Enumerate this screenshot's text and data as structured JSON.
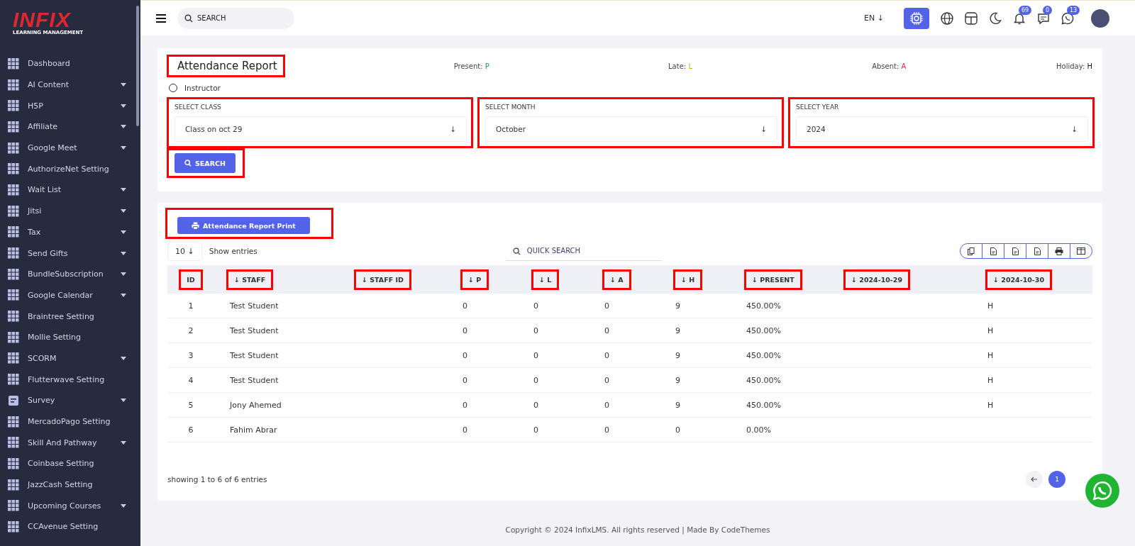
{
  "logo": {
    "brand": "INFIX",
    "tagline": "LEARNING MANAGEMENT"
  },
  "sidebar": {
    "items": [
      {
        "label": "Dashboard",
        "kind": "grid",
        "has_submenu": false
      },
      {
        "label": "AI Content",
        "kind": "grid",
        "has_submenu": true
      },
      {
        "label": "H5P",
        "kind": "grid",
        "has_submenu": true
      },
      {
        "label": "Affiliate",
        "kind": "grid",
        "has_submenu": true
      },
      {
        "label": "Google Meet",
        "kind": "grid",
        "has_submenu": true
      },
      {
        "label": "AuthorizeNet Setting",
        "kind": "grid",
        "has_submenu": false
      },
      {
        "label": "Wait List",
        "kind": "grid",
        "has_submenu": true
      },
      {
        "label": "Jitsi",
        "kind": "grid",
        "has_submenu": true
      },
      {
        "label": "Tax",
        "kind": "grid",
        "has_submenu": true
      },
      {
        "label": "Send Gifts",
        "kind": "grid",
        "has_submenu": true
      },
      {
        "label": "BundleSubscription",
        "kind": "grid",
        "has_submenu": true
      },
      {
        "label": "Google Calendar",
        "kind": "grid",
        "has_submenu": true
      },
      {
        "label": "Braintree Setting",
        "kind": "grid",
        "has_submenu": false
      },
      {
        "label": "Mollie Setting",
        "kind": "grid",
        "has_submenu": false
      },
      {
        "label": "SCORM",
        "kind": "grid",
        "has_submenu": true
      },
      {
        "label": "Flutterwave Setting",
        "kind": "grid",
        "has_submenu": false
      },
      {
        "label": "Survey",
        "kind": "form",
        "has_submenu": true
      },
      {
        "label": "MercadoPago Setting",
        "kind": "grid",
        "has_submenu": false
      },
      {
        "label": "Skill And Pathway",
        "kind": "grid",
        "has_submenu": true
      },
      {
        "label": "Coinbase Setting",
        "kind": "grid",
        "has_submenu": false
      },
      {
        "label": "JazzCash Setting",
        "kind": "grid",
        "has_submenu": false
      },
      {
        "label": "Upcoming Courses",
        "kind": "grid",
        "has_submenu": true
      },
      {
        "label": "CCAvenue Setting",
        "kind": "grid",
        "has_submenu": false
      }
    ]
  },
  "topbar": {
    "search_placeholder": "SEARCH",
    "language": "EN",
    "language_arrow": "↓",
    "badges": [
      {
        "kind": "bell",
        "count": "69"
      },
      {
        "kind": "chat",
        "count": "0"
      },
      {
        "kind": "whatsapp",
        "count": "13"
      }
    ]
  },
  "report": {
    "title": "Attendance Report",
    "title_highlighted": true,
    "legend": [
      {
        "label": "Present: ",
        "code": "P",
        "color": "#1aa34a"
      },
      {
        "label": "Late: ",
        "code": "L",
        "color": "#e0b000"
      },
      {
        "label": "Absent: ",
        "code": "A",
        "color": "#e0303a"
      },
      {
        "label": "Holiday: ",
        "code": "H",
        "color": "#222222"
      }
    ],
    "role": {
      "label": "Instructor",
      "selected": false
    },
    "selects": [
      {
        "label": "SELECT CLASS",
        "value": "Class on oct 29",
        "highlighted": true
      },
      {
        "label": "SELECT MONTH",
        "value": "October",
        "highlighted": true
      },
      {
        "label": "SELECT YEAR",
        "value": "2024",
        "highlighted": true
      }
    ],
    "select_arrow": "↓",
    "search_button": {
      "label": "SEARCH",
      "highlighted": true
    }
  },
  "table_card": {
    "print_button": {
      "label": "Attendance Report Print",
      "highlighted": true
    },
    "page_size": "10",
    "page_size_arrow": "↓",
    "show_entries": "Show entries",
    "quick_search_placeholder": "QUICK SEARCH",
    "columns": [
      {
        "label": "ID",
        "sortable": false,
        "highlighted": true
      },
      {
        "label": "STAFF",
        "sortable": true,
        "highlighted": true
      },
      {
        "label": "STAFF ID",
        "sortable": true,
        "highlighted": true
      },
      {
        "label": "P",
        "sortable": true,
        "highlighted": true
      },
      {
        "label": "L",
        "sortable": true,
        "highlighted": true
      },
      {
        "label": "A",
        "sortable": true,
        "highlighted": true
      },
      {
        "label": "H",
        "sortable": true,
        "highlighted": true
      },
      {
        "label": "PRESENT",
        "sortable": true,
        "highlighted": true
      },
      {
        "label": "2024-10-29",
        "sortable": true,
        "highlighted": true
      },
      {
        "label": "2024-10-30",
        "sortable": true,
        "highlighted": true
      }
    ],
    "sort_arrow": "↓",
    "rows": [
      [
        "1",
        "Test Student",
        "",
        "0",
        "0",
        "0",
        "9",
        "450.00%",
        "",
        "H"
      ],
      [
        "2",
        "Test Student",
        "",
        "0",
        "0",
        "0",
        "9",
        "450.00%",
        "",
        "H"
      ],
      [
        "3",
        "Test Student",
        "",
        "0",
        "0",
        "0",
        "9",
        "450.00%",
        "",
        "H"
      ],
      [
        "4",
        "Test Student",
        "",
        "0",
        "0",
        "0",
        "9",
        "450.00%",
        "",
        "H"
      ],
      [
        "5",
        "Jony Ahemed",
        "",
        "0",
        "0",
        "0",
        "9",
        "450.00%",
        "",
        "H"
      ],
      [
        "6",
        "Fahim Abrar",
        "",
        "0",
        "0",
        "0",
        "0",
        "0.00%",
        "",
        ""
      ]
    ],
    "footer_text": "showing 1 to 6 of 6 entries",
    "pages": [
      {
        "label": "1",
        "selected": true
      }
    ]
  },
  "footer": "Copyright © 2024 InfixLMS. All rights reserved | Made By CodeThemes"
}
